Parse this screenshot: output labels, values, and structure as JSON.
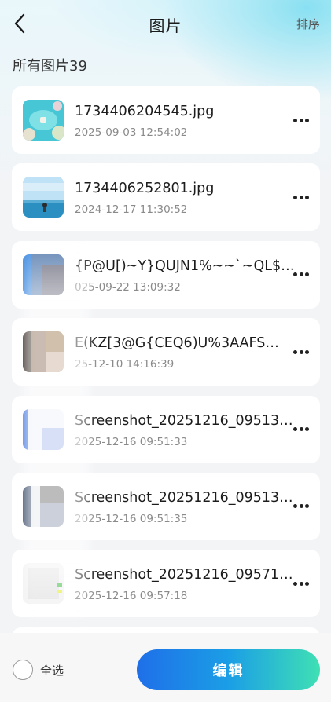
{
  "header": {
    "title": "图片",
    "sort_label": "排序"
  },
  "summary": {
    "count_text": "所有图片39"
  },
  "files": [
    {
      "name": "1734406204545.jpg",
      "date": "2025-09-03 12:54:02",
      "thumb": "beach-photo"
    },
    {
      "name": "1734406252801.jpg",
      "date": "2024-12-17 11:30:52",
      "thumb": "sea-photo"
    },
    {
      "name": "{P@U[)~Y}QUJN1%~~`~QL$7…",
      "date": "025-09-22 13:09:32",
      "thumb": "blurred-photo"
    },
    {
      "name": "E(KZ[3@G{CEQ6)U%3AAFS…",
      "date": "25-12-10 14:16:39",
      "thumb": "blurred-photo"
    },
    {
      "name": "Screenshot_20251216_09513…",
      "date": "2025-12-16 09:51:33",
      "thumb": "blurred-screenshot"
    },
    {
      "name": "Screenshot_20251216_09513…",
      "date": "2025-12-16 09:51:35",
      "thumb": "blurred-screenshot"
    },
    {
      "name": "Screenshot_20251216_09571…",
      "date": "2025-12-16 09:57:18",
      "thumb": "blurred-screenshot"
    }
  ],
  "footer": {
    "select_all_label": "全选",
    "edit_label": "编辑"
  },
  "colors": {
    "accent_start": "#1f6fe8",
    "accent_end": "#3fe0b4",
    "background": "#f3f4f6"
  }
}
